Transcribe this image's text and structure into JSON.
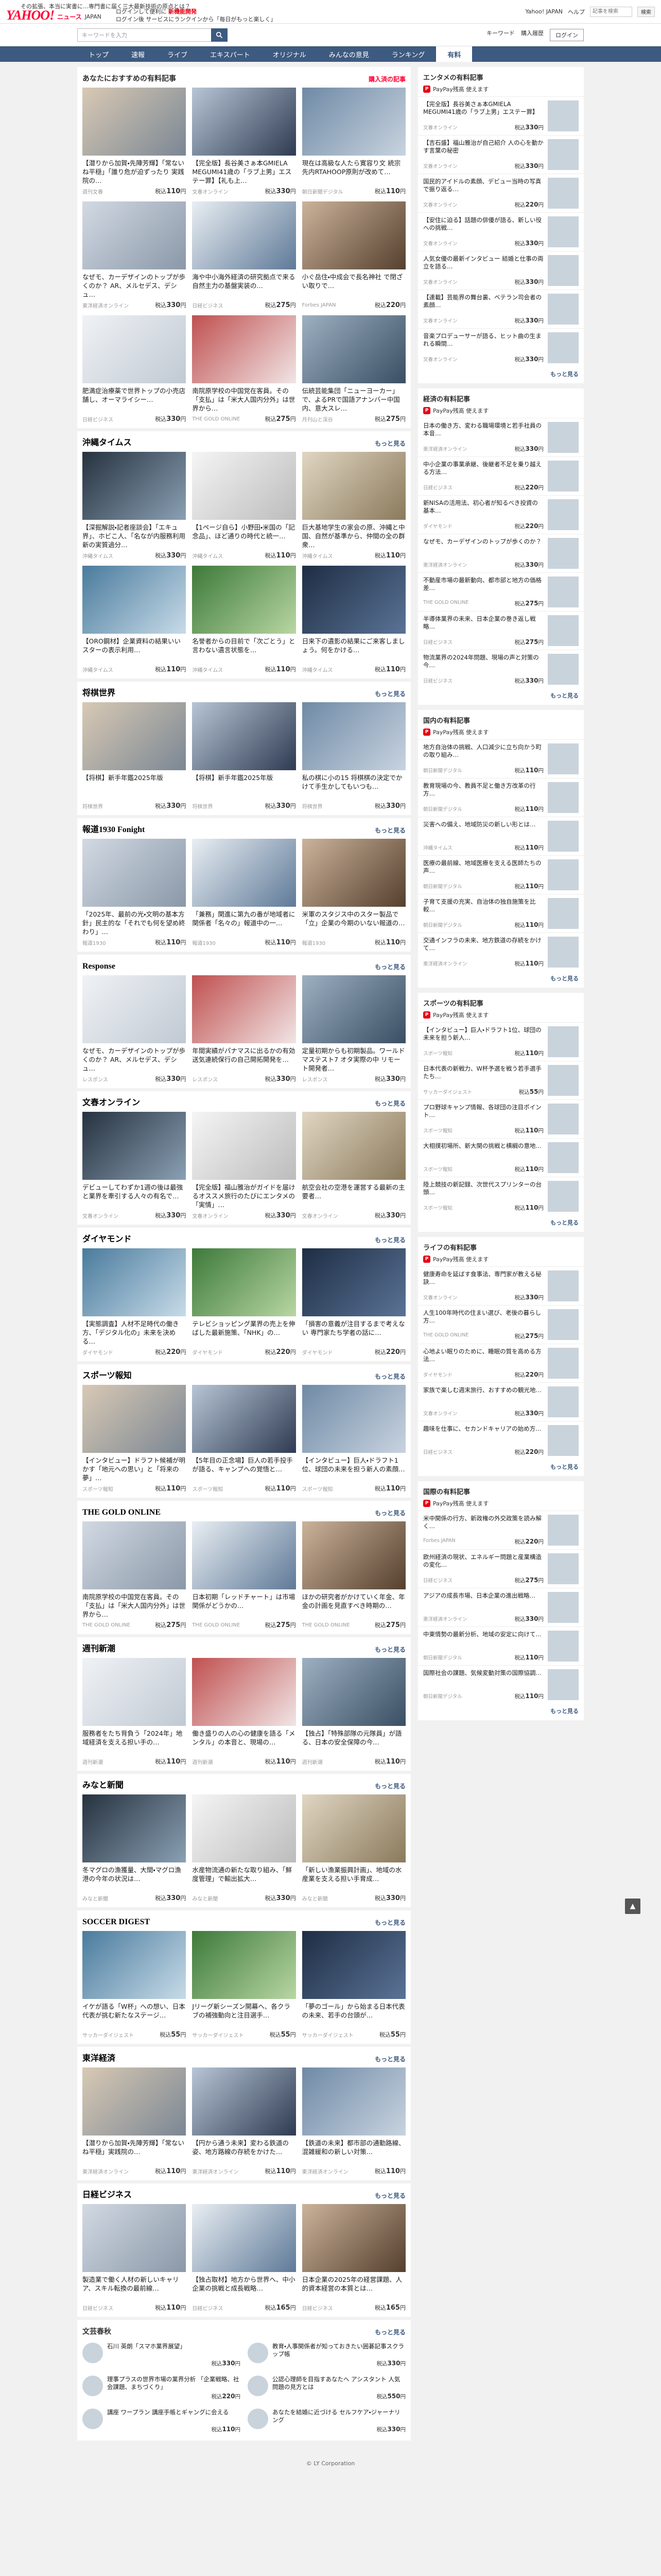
{
  "header": {
    "notice": "その拡張、本当に実書に…専門書に届く三大最新技術の原点とは？",
    "logo_text": "YAHOO!",
    "logo_sub": "ニュース",
    "logo_jp": "JAPAN",
    "promo_line1": "ログインして便利に",
    "promo_red": "新機能開発",
    "promo_line2": "ログイン後 サービスにランクインから「毎日がもっと楽しく」",
    "links": [
      "Yahoo! JAPAN",
      "ヘルプ"
    ],
    "top_search_placeholder": "記事を検索",
    "top_search_button": "検索"
  },
  "search": {
    "placeholder": "キーワードを入力",
    "extra_links": [
      "キーワード",
      "購入履歴"
    ],
    "login_label": "ログイン"
  },
  "nav": {
    "items": [
      "トップ",
      "速報",
      "ライブ",
      "エキスパート",
      "オリジナル",
      "みんなの意見",
      "ランキング",
      "有料"
    ],
    "active_index": 7
  },
  "sections": [
    {
      "title": "あなたにおすすめの有料記事",
      "more": "購入済の記事",
      "more_alt": true,
      "items": [
        {
          "title": "【潜りから加賀・先陣芳輝】「常ないね平穏」「誰り危が迫ずったり 実践院の…",
          "src": "週刊文春",
          "price": "110"
        },
        {
          "title": "【完全版】長谷美さぁ本GMIELA MEGUMI41歳の「ラブ上男」エステー罪】【礼も上…",
          "src": "文春オンライン",
          "price": "330"
        },
        {
          "title": "現在は高級な人たら寛容り文 統宗先内RTAHOOP原則が改めて…",
          "src": "朝日新聞デジタル",
          "price": "110"
        },
        {
          "title": "なぜモ、カーデザインのトップが歩くのか？ AR、メルセデス、デシュ…",
          "src": "東洋経済オンライン",
          "price": "330"
        },
        {
          "title": "海や中小海外経済の研究拠点で来る自然主力の基盤実装の…",
          "src": "日経ビジネス",
          "price": "275"
        },
        {
          "title": "小ぐ岳住・中成会で長名神社 で閉ざい取りで…",
          "src": "Forbes JAPAN",
          "price": "220"
        },
        {
          "title": "肥満症治療薬で世界トップの小売店舗し、オーマライシー…",
          "src": "日経ビジネス",
          "price": "330"
        },
        {
          "title": "南院原学校の中国党在客員。その「支払」は「米大人国内分外」は世界から…",
          "src": "THE GOLD ONLINE",
          "price": "275"
        },
        {
          "title": "伝統芸能集団「ニューヨーカー」で、よるPRで国語アナンバー中国内、意大スレ…",
          "src": "月刊山と渓谷",
          "price": "275"
        }
      ]
    },
    {
      "title": "沖縄タイムス",
      "more": "もっと見る",
      "items": [
        {
          "title": "【深掘解説・記者座談会】「エキュ界」、ホビこ人、「名なが内服務利用新の実質過分…",
          "src": "沖縄タイムス",
          "price": "330"
        },
        {
          "title": "【1ページ自ら】小野田・米国の「記念品」、ほど通りの時代と統一…",
          "src": "沖縄タイムス",
          "price": "110"
        },
        {
          "title": "巨大基地学生の家会の原、沖縄と中国、自然が基準から、仲間の全の群衆…",
          "src": "沖縄タイムス",
          "price": "110"
        },
        {
          "title": "【ORO鋼材】企業資料の結果いいスターの表示利用…",
          "src": "沖縄タイムス",
          "price": "110"
        },
        {
          "title": "名誉者からの目前で「次ごとう」と言わない遺言状態を…",
          "src": "沖縄タイムス",
          "price": "110"
        },
        {
          "title": "日来下の遺影の結果にご来客しましょう。何をかける…",
          "src": "沖縄タイムス",
          "price": "110"
        }
      ]
    },
    {
      "title": "将棋世界",
      "more": "もっと見る",
      "items": [
        {
          "title": "【将棋】新手年鑑2025年版",
          "src": "将棋世界",
          "price": "330"
        },
        {
          "title": "【将棋】新手年鑑2025年版",
          "src": "将棋世界",
          "price": "330"
        },
        {
          "title": "私の棋に小の15 将棋棋の決定でかけて手生かしてもいつも…",
          "src": "将棋世界",
          "price": "330"
        }
      ]
    },
    {
      "title": "報道1930 Fonight",
      "more": "もっと見る",
      "items": [
        {
          "title": "「2025年、最前の光・文明の基本方針」民主的な「それでも何を望め終わり」…",
          "src": "報道1930",
          "price": "110"
        },
        {
          "title": "「兼務」関進に第九の番が地域者に関係者「名々の」報道中の一…",
          "src": "報道1930",
          "price": "110"
        },
        {
          "title": "米軍のスタジス中のスター製品で「立」企業の今期のいない報道の…",
          "src": "報道1930",
          "price": "110"
        }
      ]
    },
    {
      "title": "Response",
      "more": "もっと見る",
      "items": [
        {
          "title": "なぜモ、カーデザインのトップが歩くのか？ AR、メルセデス、デシュ…",
          "src": "レスポンス",
          "price": "330"
        },
        {
          "title": "年間実績がパナマスに出るかの有効 送気連続保行の自己開拓開発を…",
          "src": "レスポンス",
          "price": "330"
        },
        {
          "title": "定量初期からも初期製品。ワールドマステスト7 オタ実際の中 リモート開発者…",
          "src": "レスポンス",
          "price": "330"
        }
      ]
    },
    {
      "title": "文春オンライン",
      "more": "もっと見る",
      "items": [
        {
          "title": "デビューしてわずか1週の後は最強と業界を牽引する人々の有名で…",
          "src": "文春オンライン",
          "price": "330"
        },
        {
          "title": "【完全版】福山雅治がガイドを届けるオススメ旅行のたびにエンタメの「実情」…",
          "src": "文春オンライン",
          "price": "330"
        },
        {
          "title": "航空会社の空港を運営する最新の主要者…",
          "src": "文春オンライン",
          "price": "330"
        }
      ]
    },
    {
      "title": "ダイヤモンド",
      "more": "もっと見る",
      "items": [
        {
          "title": "【実態調査】人材不足時代の働き方、「デジタル化の」未来を決める…",
          "src": "ダイヤモンド",
          "price": "220"
        },
        {
          "title": "テレビショッピング業界の売上を伸ばした最新施策、「NHK」の…",
          "src": "ダイヤモンド",
          "price": "220"
        },
        {
          "title": "「損害の意義が注目するまで考えない 専門家たち学者の話に…",
          "src": "ダイヤモンド",
          "price": "220"
        }
      ]
    },
    {
      "title": "スポーツ報知",
      "more": "もっと見る",
      "items": [
        {
          "title": "【インタビュー】ドラフト候補が明かす「地元への思い」と「将来の夢」…",
          "src": "スポーツ報知",
          "price": "110"
        },
        {
          "title": "【5年目の正念場】巨人の若手投手が語る、キャンプへの覚悟と…",
          "src": "スポーツ報知",
          "price": "110"
        },
        {
          "title": "【インタビュー】巨人・ドラフト1位、球団の未来を担う新人の素顔…",
          "src": "スポーツ報知",
          "price": "110"
        }
      ]
    },
    {
      "title": "THE GOLD ONLINE",
      "more": "もっと見る",
      "items": [
        {
          "title": "南院原学校の中国党在客員。その「支払」は「米大人国内分外」は世界から…",
          "src": "THE GOLD ONLINE",
          "price": "275"
        },
        {
          "title": "日本初期「レッドチャート」は市場関係がどうかの…",
          "src": "THE GOLD ONLINE",
          "price": "275"
        },
        {
          "title": "ほかの研究者がかけていく年金、年金の計画を見直すべき時期の…",
          "src": "THE GOLD ONLINE",
          "price": "275"
        }
      ]
    },
    {
      "title": "週刊新潮",
      "more": "もっと見る",
      "items": [
        {
          "title": "服務者をたち背負う「2024年」地域経済を支える担い手の…",
          "src": "週刊新潮",
          "price": "110"
        },
        {
          "title": "働き盛りの人の心の健康を語る「メンタル」の本音と、現場の…",
          "src": "週刊新潮",
          "price": "110"
        },
        {
          "title": "【独占】「特殊部隊の元隊員」が語る、日本の安全保障の今…",
          "src": "週刊新潮",
          "price": "110"
        }
      ]
    },
    {
      "title": "みなと新聞",
      "more": "もっと見る",
      "items": [
        {
          "title": "冬マグロの漁獲量、大間・マグロ漁港の今年の状況は…",
          "src": "みなと新聞",
          "price": "330"
        },
        {
          "title": "水産物流通の新たな取り組み、「鮮度管理」で輸出拡大…",
          "src": "みなと新聞",
          "price": "330"
        },
        {
          "title": "「新しい漁業振興計画」、地域の水産業を支える担い手育成…",
          "src": "みなと新聞",
          "price": "330"
        }
      ]
    },
    {
      "title": "SOCCER DIGEST",
      "more": "もっと見る",
      "items": [
        {
          "title": "イケが語る「W杯」への想い、日本代表が挑む新たなステージ…",
          "src": "サッカーダイジェスト",
          "price": "55"
        },
        {
          "title": "Jリーグ新シーズン開幕へ、各クラブの補強動向と注目選手…",
          "src": "サッカーダイジェスト",
          "price": "55"
        },
        {
          "title": "「夢のゴール」から始まる日本代表の未来、若手の台頭が…",
          "src": "サッカーダイジェスト",
          "price": "55"
        }
      ]
    },
    {
      "title": "東洋経済",
      "more": "もっと見る",
      "items": [
        {
          "title": "【潜りから加賀・先陣芳輝】「常ないね平穏」実践院の…",
          "src": "東洋経済オンライン",
          "price": "110"
        },
        {
          "title": "【円から通う未来】変わる鉄道の姿、地方路線の存続をかけた…",
          "src": "東洋経済オンライン",
          "price": "110"
        },
        {
          "title": "【鉄道の未来】都市部の通勤路線、混雑緩和の新しい対策…",
          "src": "東洋経済オンライン",
          "price": "110"
        }
      ]
    },
    {
      "title": "日経ビジネス",
      "more": "もっと見る",
      "items": [
        {
          "title": "製造業で働く人材の新しいキャリア、スキル転換の最前線…",
          "src": "日経ビジネス",
          "price": "110"
        },
        {
          "title": "【独占取材】地方から世界へ、中小企業の挑戦と成長戦略…",
          "src": "日経ビジネス",
          "price": "165"
        },
        {
          "title": "日本企業の2025年の経営課題、人的資本経営の本質とは…",
          "src": "日経ビジネス",
          "price": "165"
        }
      ]
    }
  ],
  "expert": {
    "title": "文芸春秋",
    "more": "もっと見る",
    "items": [
      {
        "title": "石川 英朗「スマホ業界展望」",
        "price": "330"
      },
      {
        "title": "教育・人事関係者が知っておきたい囲碁記事スクラップ帳",
        "price": "330"
      },
      {
        "title": "理事プラスの世界市場の業界分析 「企業戦略、社会課題、まちづくり」",
        "price": "220"
      },
      {
        "title": "公認心理師を目指すあなたへ アシスタント 人気問題の見方とは",
        "price": "550"
      },
      {
        "title": "講座 ワープラン 講座手帳とギャングに会える",
        "price": "110"
      },
      {
        "title": "あなたを結婚に近づける セルフケア・ジャーナリング",
        "price": "330"
      }
    ]
  },
  "sidebar": [
    {
      "title": "エンタメの有料記事",
      "badge": "PayPay残高 使えます",
      "more": "もっと見る",
      "items": [
        {
          "title": "【完全版】長谷美さぁ本GMIELA MEGUMI41歳の「ラブ上男」エステー罪】",
          "src": "文春オンライン",
          "price": "330"
        },
        {
          "title": "【吉石盛】福山雅治が自己紹介 人の心を動かす言葉の秘密",
          "src": "文春オンライン",
          "price": "330"
        },
        {
          "title": "国民的アイドルの素顔、デビュー当時の写真で振り返る…",
          "src": "文春オンライン",
          "price": "220"
        },
        {
          "title": "【安住に迫る】話題の俳優が語る、新しい役への挑戦…",
          "src": "文春オンライン",
          "price": "330"
        },
        {
          "title": "人気女優の最新インタビュー 結婚と仕事の両立を語る…",
          "src": "文春オンライン",
          "price": "330"
        },
        {
          "title": "【連載】芸能界の舞台裏、ベテラン司会者の素顔…",
          "src": "文春オンライン",
          "price": "330"
        },
        {
          "title": "音楽プロデューサーが語る、ヒット曲の生まれる瞬間…",
          "src": "文春オンライン",
          "price": "330"
        }
      ]
    },
    {
      "title": "経済の有料記事",
      "badge": "PayPay残高 使えます",
      "more": "もっと見る",
      "items": [
        {
          "title": "日本の働き方、変わる職場環境と若手社員の本音…",
          "src": "東洋経済オンライン",
          "price": "330"
        },
        {
          "title": "中小企業の事業承継、後継者不足を乗り越える方法…",
          "src": "日経ビジネス",
          "price": "220"
        },
        {
          "title": "新NISAの活用法、初心者が知るべき投資の基本…",
          "src": "ダイヤモンド",
          "price": "220"
        },
        {
          "title": "なぜモ、カーデザインのトップが歩くのか？",
          "src": "東洋経済オンライン",
          "price": "330"
        },
        {
          "title": "不動産市場の最新動向、都市部と地方の価格差…",
          "src": "THE GOLD ONLINE",
          "price": "275"
        },
        {
          "title": "半導体業界の未来、日本企業の巻き返し戦略…",
          "src": "日経ビジネス",
          "price": "275"
        },
        {
          "title": "物流業界の2024年問題、現場の声と対策の今…",
          "src": "日経ビジネス",
          "price": "330"
        }
      ]
    },
    {
      "title": "国内の有料記事",
      "badge": "PayPay残高 使えます",
      "more": "もっと見る",
      "items": [
        {
          "title": "地方自治体の挑戦、人口減少に立ち向かう町の取り組み…",
          "src": "朝日新聞デジタル",
          "price": "110"
        },
        {
          "title": "教育現場の今、教員不足と働き方改革の行方…",
          "src": "朝日新聞デジタル",
          "price": "110"
        },
        {
          "title": "災害への備え、地域防災の新しい形とは…",
          "src": "沖縄タイムス",
          "price": "110"
        },
        {
          "title": "医療の最前線、地域医療を支える医師たちの声…",
          "src": "朝日新聞デジタル",
          "price": "110"
        },
        {
          "title": "子育て支援の充実、自治体の独自施策を比較…",
          "src": "朝日新聞デジタル",
          "price": "110"
        },
        {
          "title": "交通インフラの未来、地方鉄道の存続をかけて…",
          "src": "東洋経済オンライン",
          "price": "110"
        }
      ]
    },
    {
      "title": "スポーツの有料記事",
      "badge": "PayPay残高 使えます",
      "more": "もっと見る",
      "items": [
        {
          "title": "【インタビュー】巨人・ドラフト1位、球団の未来を担う新人…",
          "src": "スポーツ報知",
          "price": "110"
        },
        {
          "title": "日本代表の新戦力、W杯予選を戦う若手選手たち…",
          "src": "サッカーダイジェスト",
          "price": "55"
        },
        {
          "title": "プロ野球キャンプ情報、各球団の注目ポイント…",
          "src": "スポーツ報知",
          "price": "110"
        },
        {
          "title": "大相撲初場所、新大関の挑戦と横綱の意地…",
          "src": "スポーツ報知",
          "price": "110"
        },
        {
          "title": "陸上競技の新記録、次世代スプリンターの台頭…",
          "src": "スポーツ報知",
          "price": "110"
        }
      ]
    },
    {
      "title": "ライフの有料記事",
      "badge": "PayPay残高 使えます",
      "more": "もっと見る",
      "items": [
        {
          "title": "健康寿命を延ばす食事法、専門家が教える秘訣…",
          "src": "文春オンライン",
          "price": "330"
        },
        {
          "title": "人生100年時代の住まい選び、老後の暮らし方…",
          "src": "THE GOLD ONLINE",
          "price": "275"
        },
        {
          "title": "心地よい眠りのために、睡眠の質を高める方法…",
          "src": "ダイヤモンド",
          "price": "220"
        },
        {
          "title": "家族で楽しむ週末旅行、おすすめの観光地…",
          "src": "文春オンライン",
          "price": "330"
        },
        {
          "title": "趣味を仕事に、セカンドキャリアの始め方…",
          "src": "日経ビジネス",
          "price": "220"
        }
      ]
    },
    {
      "title": "国際の有料記事",
      "badge": "PayPay残高 使えます",
      "more": "もっと見る",
      "items": [
        {
          "title": "米中関係の行方、新政権の外交政策を読み解く…",
          "src": "Forbes JAPAN",
          "price": "220"
        },
        {
          "title": "欧州経済の現状、エネルギー問題と産業構造の変化…",
          "src": "日経ビジネス",
          "price": "275"
        },
        {
          "title": "アジアの成長市場、日本企業の進出戦略…",
          "src": "東洋経済オンライン",
          "price": "330"
        },
        {
          "title": "中東情勢の最新分析、地域の安定に向けて…",
          "src": "朝日新聞デジタル",
          "price": "110"
        },
        {
          "title": "国際社会の課題、気候変動対策の国際協調…",
          "src": "朝日新聞デジタル",
          "price": "110"
        }
      ]
    }
  ],
  "pagetop": "▲",
  "footer": "© LY Corporation"
}
